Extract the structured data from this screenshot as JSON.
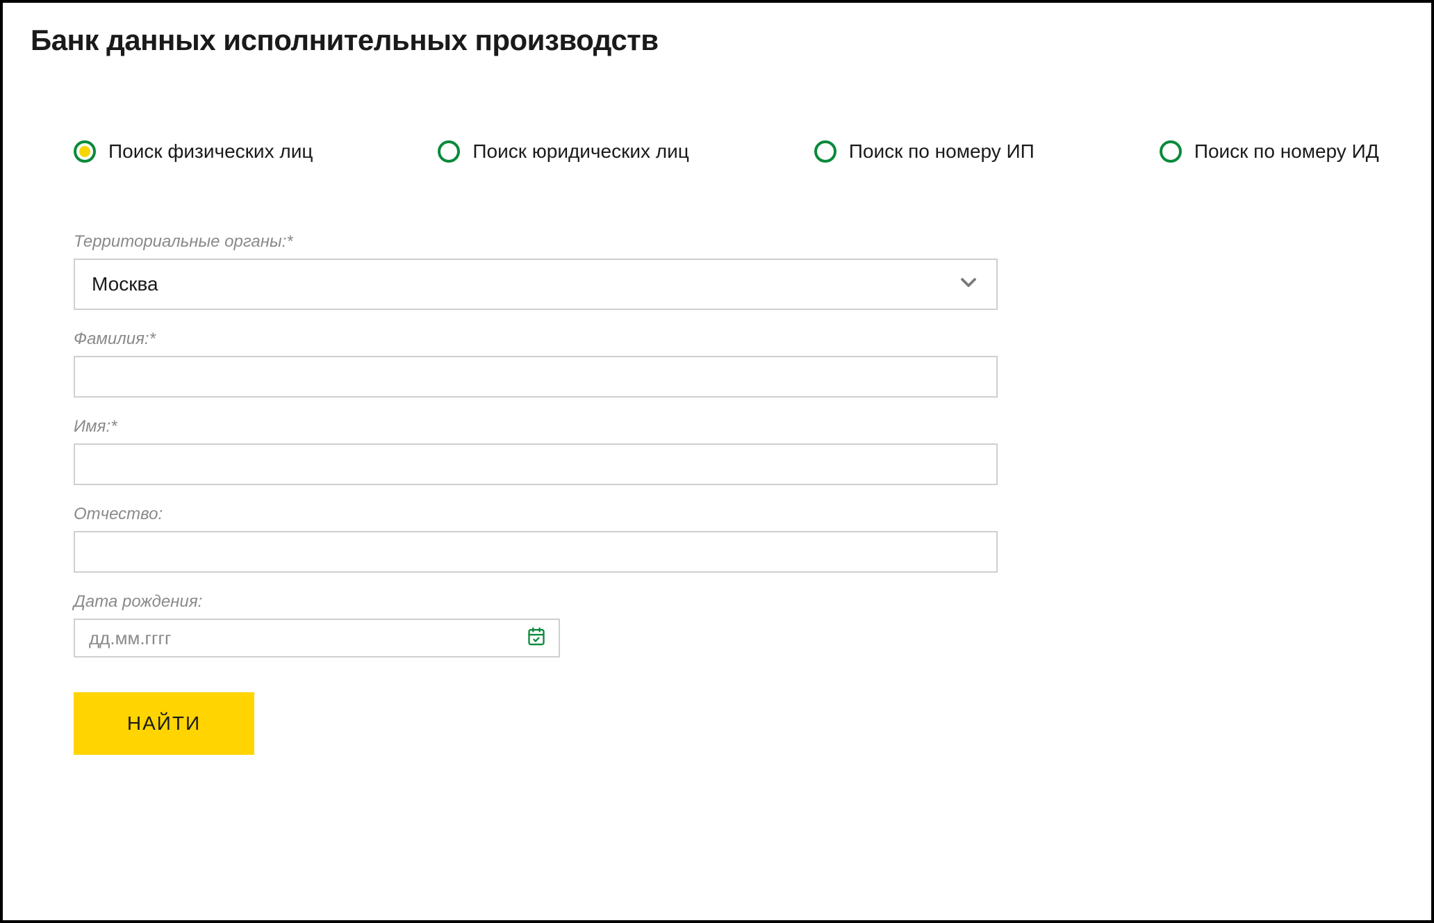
{
  "title": "Банк данных исполнительных производств",
  "radios": {
    "individuals": {
      "label": "Поиск физических лиц",
      "selected": true
    },
    "legal": {
      "label": "Поиск юридических лиц",
      "selected": false
    },
    "ip_number": {
      "label": "Поиск по номеру ИП",
      "selected": false
    },
    "id_number": {
      "label": "Поиск по номеру ИД",
      "selected": false
    }
  },
  "form": {
    "territory": {
      "label": "Территориальные органы:*",
      "value": "Москва"
    },
    "surname": {
      "label": "Фамилия:*",
      "value": ""
    },
    "firstname": {
      "label": "Имя:*",
      "value": ""
    },
    "patronymic": {
      "label": "Отчество:",
      "value": ""
    },
    "birthdate": {
      "label": "Дата рождения:",
      "placeholder": "дд.мм.гггг"
    }
  },
  "submit_label": "НАЙТИ"
}
